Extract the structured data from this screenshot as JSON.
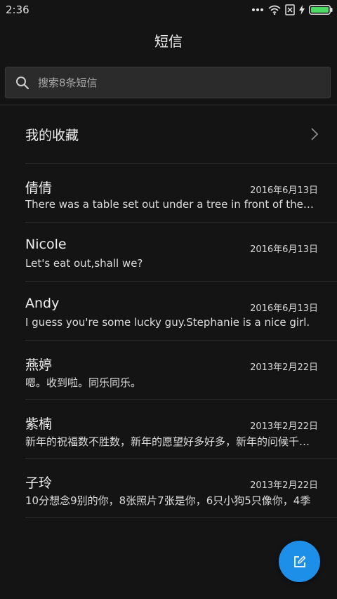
{
  "status_bar": {
    "time": "2:36",
    "icons": [
      "more-dots-icon",
      "wifi-icon",
      "no-sim-icon",
      "charging-icon",
      "battery-icon"
    ],
    "battery_color": "#4cd964"
  },
  "header": {
    "title": "短信"
  },
  "search": {
    "placeholder": "搜索8条短信"
  },
  "favorites": {
    "label": "我的收藏"
  },
  "threads": [
    {
      "name": "倩倩",
      "date": "2016年6月13日",
      "preview": "There was a table set out under a tree in front of the house"
    },
    {
      "name": "Nicole",
      "date": "2016年6月13日",
      "preview": "Let's eat out,shall we?"
    },
    {
      "name": "Andy",
      "date": "2016年6月13日",
      "preview": "I guess you're some lucky guy.Stephanie is a nice girl."
    },
    {
      "name": "燕婷",
      "date": "2013年2月22日",
      "preview": "嗯。收到啦。同乐同乐。"
    },
    {
      "name": "紫楠",
      "date": "2013年2月22日",
      "preview": "新年的祝福数不胜数，新年的愿望好多好多，新年的问候千千万万"
    },
    {
      "name": "子玲",
      "date": "2013年2月22日",
      "preview": "10分想念9别的你，8张照片7张是你，6只小狗5只像你，4季"
    }
  ],
  "fab": {
    "icon": "compose-icon",
    "color": "#1e8fe8"
  }
}
